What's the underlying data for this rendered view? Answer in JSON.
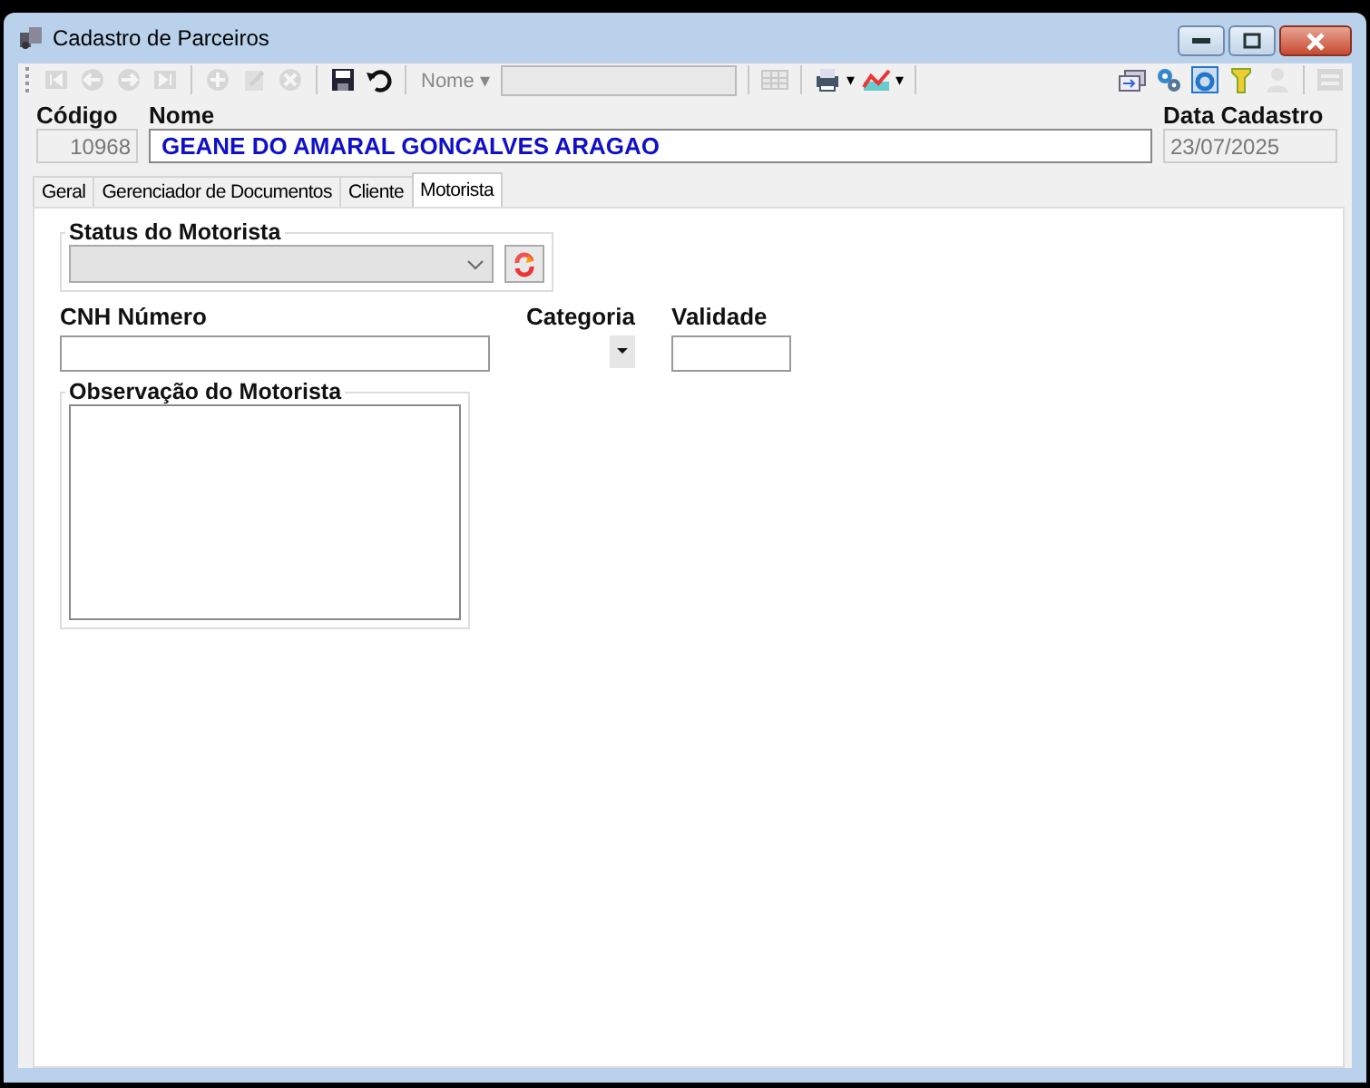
{
  "window": {
    "title": "Cadastro de Parceiros"
  },
  "toolbar": {
    "left": [
      {
        "kind": "first",
        "disabled": true
      },
      {
        "kind": "prev",
        "disabled": true
      },
      {
        "kind": "next",
        "disabled": true
      },
      {
        "kind": "last",
        "disabled": true
      },
      {
        "kind": "sep"
      },
      {
        "kind": "add",
        "disabled": true
      },
      {
        "kind": "edit",
        "disabled": true
      },
      {
        "kind": "delete",
        "disabled": true
      },
      {
        "kind": "sep"
      },
      {
        "kind": "save",
        "disabled": false
      },
      {
        "kind": "undo",
        "disabled": false
      },
      {
        "kind": "sep"
      }
    ],
    "search": {
      "label": "Nome",
      "caret": "▾"
    },
    "middle": [
      {
        "kind": "sep"
      },
      {
        "kind": "grid",
        "disabled": true
      },
      {
        "kind": "sep"
      },
      {
        "kind": "print",
        "disabled": false,
        "caret": "▾"
      },
      {
        "kind": "chart",
        "disabled": false,
        "caret": "▾"
      },
      {
        "kind": "sep"
      }
    ],
    "right": [
      {
        "kind": "windows",
        "disabled": false
      },
      {
        "kind": "gears",
        "disabled": false
      },
      {
        "kind": "refresh",
        "disabled": false
      },
      {
        "kind": "filter",
        "disabled": false
      },
      {
        "kind": "person",
        "disabled": true
      },
      {
        "kind": "sep"
      },
      {
        "kind": "panel",
        "disabled": true
      }
    ]
  },
  "header": {
    "code_label": "Código",
    "code": "10968",
    "name_label": "Nome",
    "name": "GEANE DO AMARAL GONCALVES ARAGAO",
    "date_label": "Data Cadastro",
    "date": "23/07/2025"
  },
  "tabs": [
    {
      "label": "Geral",
      "selected": false
    },
    {
      "label": "Gerenciador de Documentos",
      "selected": false
    },
    {
      "label": "Cliente",
      "selected": false
    },
    {
      "label": "Motorista",
      "selected": true
    }
  ],
  "motorista": {
    "status_label": "Status do Motorista",
    "cnh_label": "CNH Número",
    "category_label": "Categoria",
    "validity_label": "Validade",
    "notes_label": "Observação do Motorista"
  }
}
